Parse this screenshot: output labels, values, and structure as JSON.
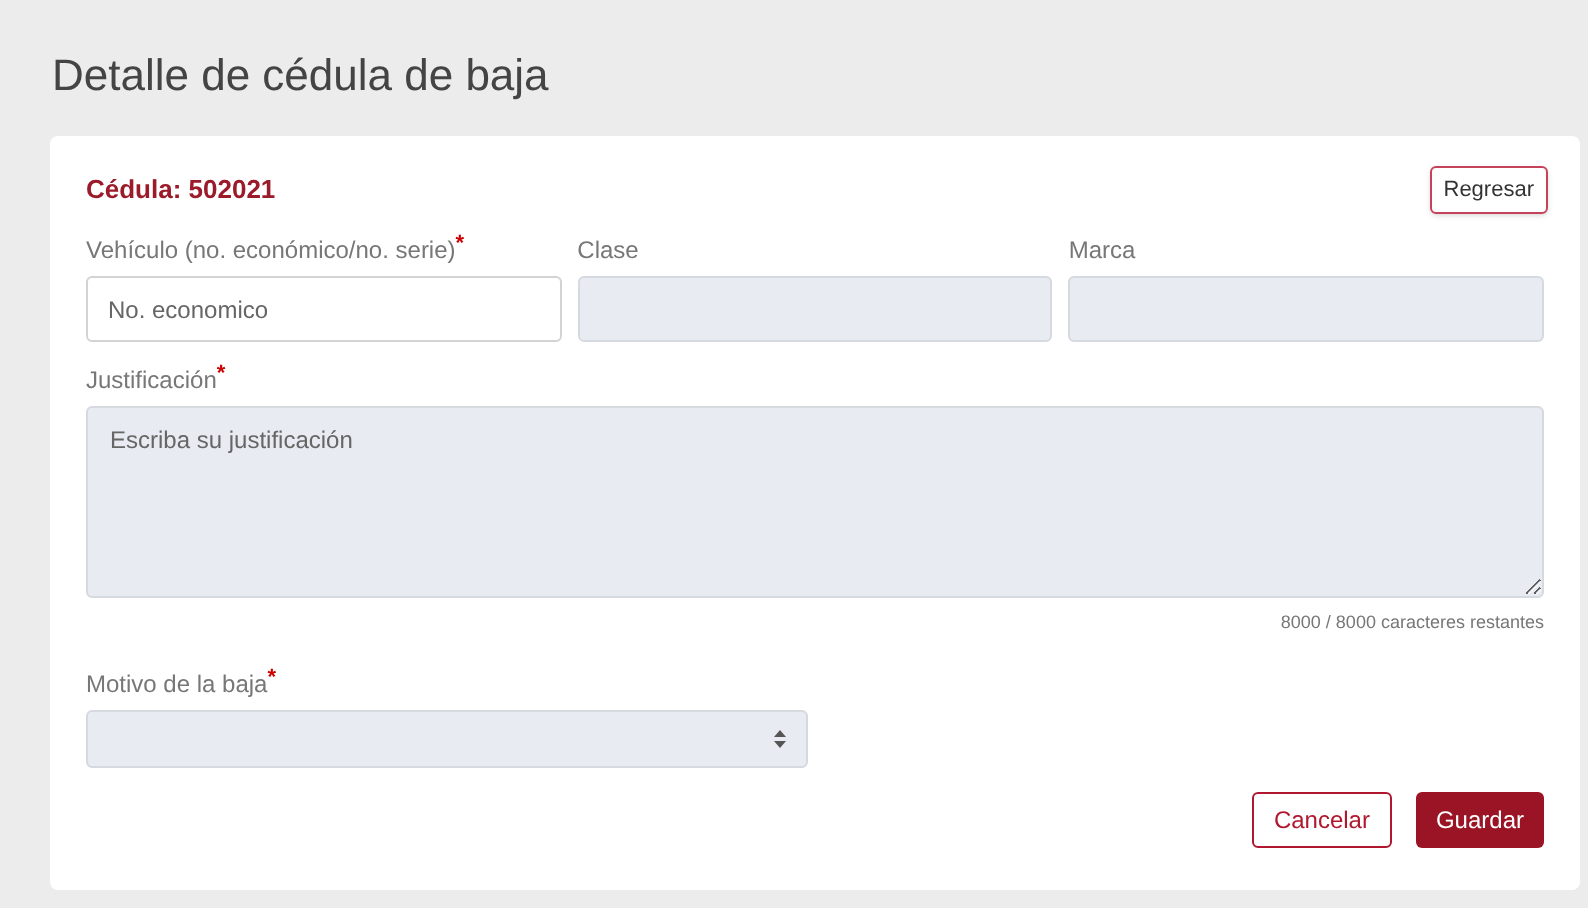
{
  "page_title": "Detalle de cédula de baja",
  "card": {
    "cedula": "Cédula: 502021",
    "back_button": "Regresar",
    "fields": [
      {
        "label": "Vehículo (no. económico/no. serie)",
        "required_mark": "*",
        "placeholder": "No. economico",
        "disabled": false
      },
      {
        "label": "Clase",
        "disabled": true
      },
      {
        "label": "Marca",
        "disabled": true
      }
    ],
    "justification": {
      "label": "Justificación",
      "required_mark": "*",
      "placeholder": "Escriba su justificación",
      "disabled": true,
      "counter": "8000 / 8000 caracteres restantes"
    },
    "reason": {
      "label": "Motivo de la baja",
      "required_mark": "*",
      "disabled": true
    },
    "buttons": [
      {
        "label": "Cancelar",
        "kind": "outline"
      },
      {
        "label": "Guardar",
        "kind": "primary"
      }
    ]
  }
}
